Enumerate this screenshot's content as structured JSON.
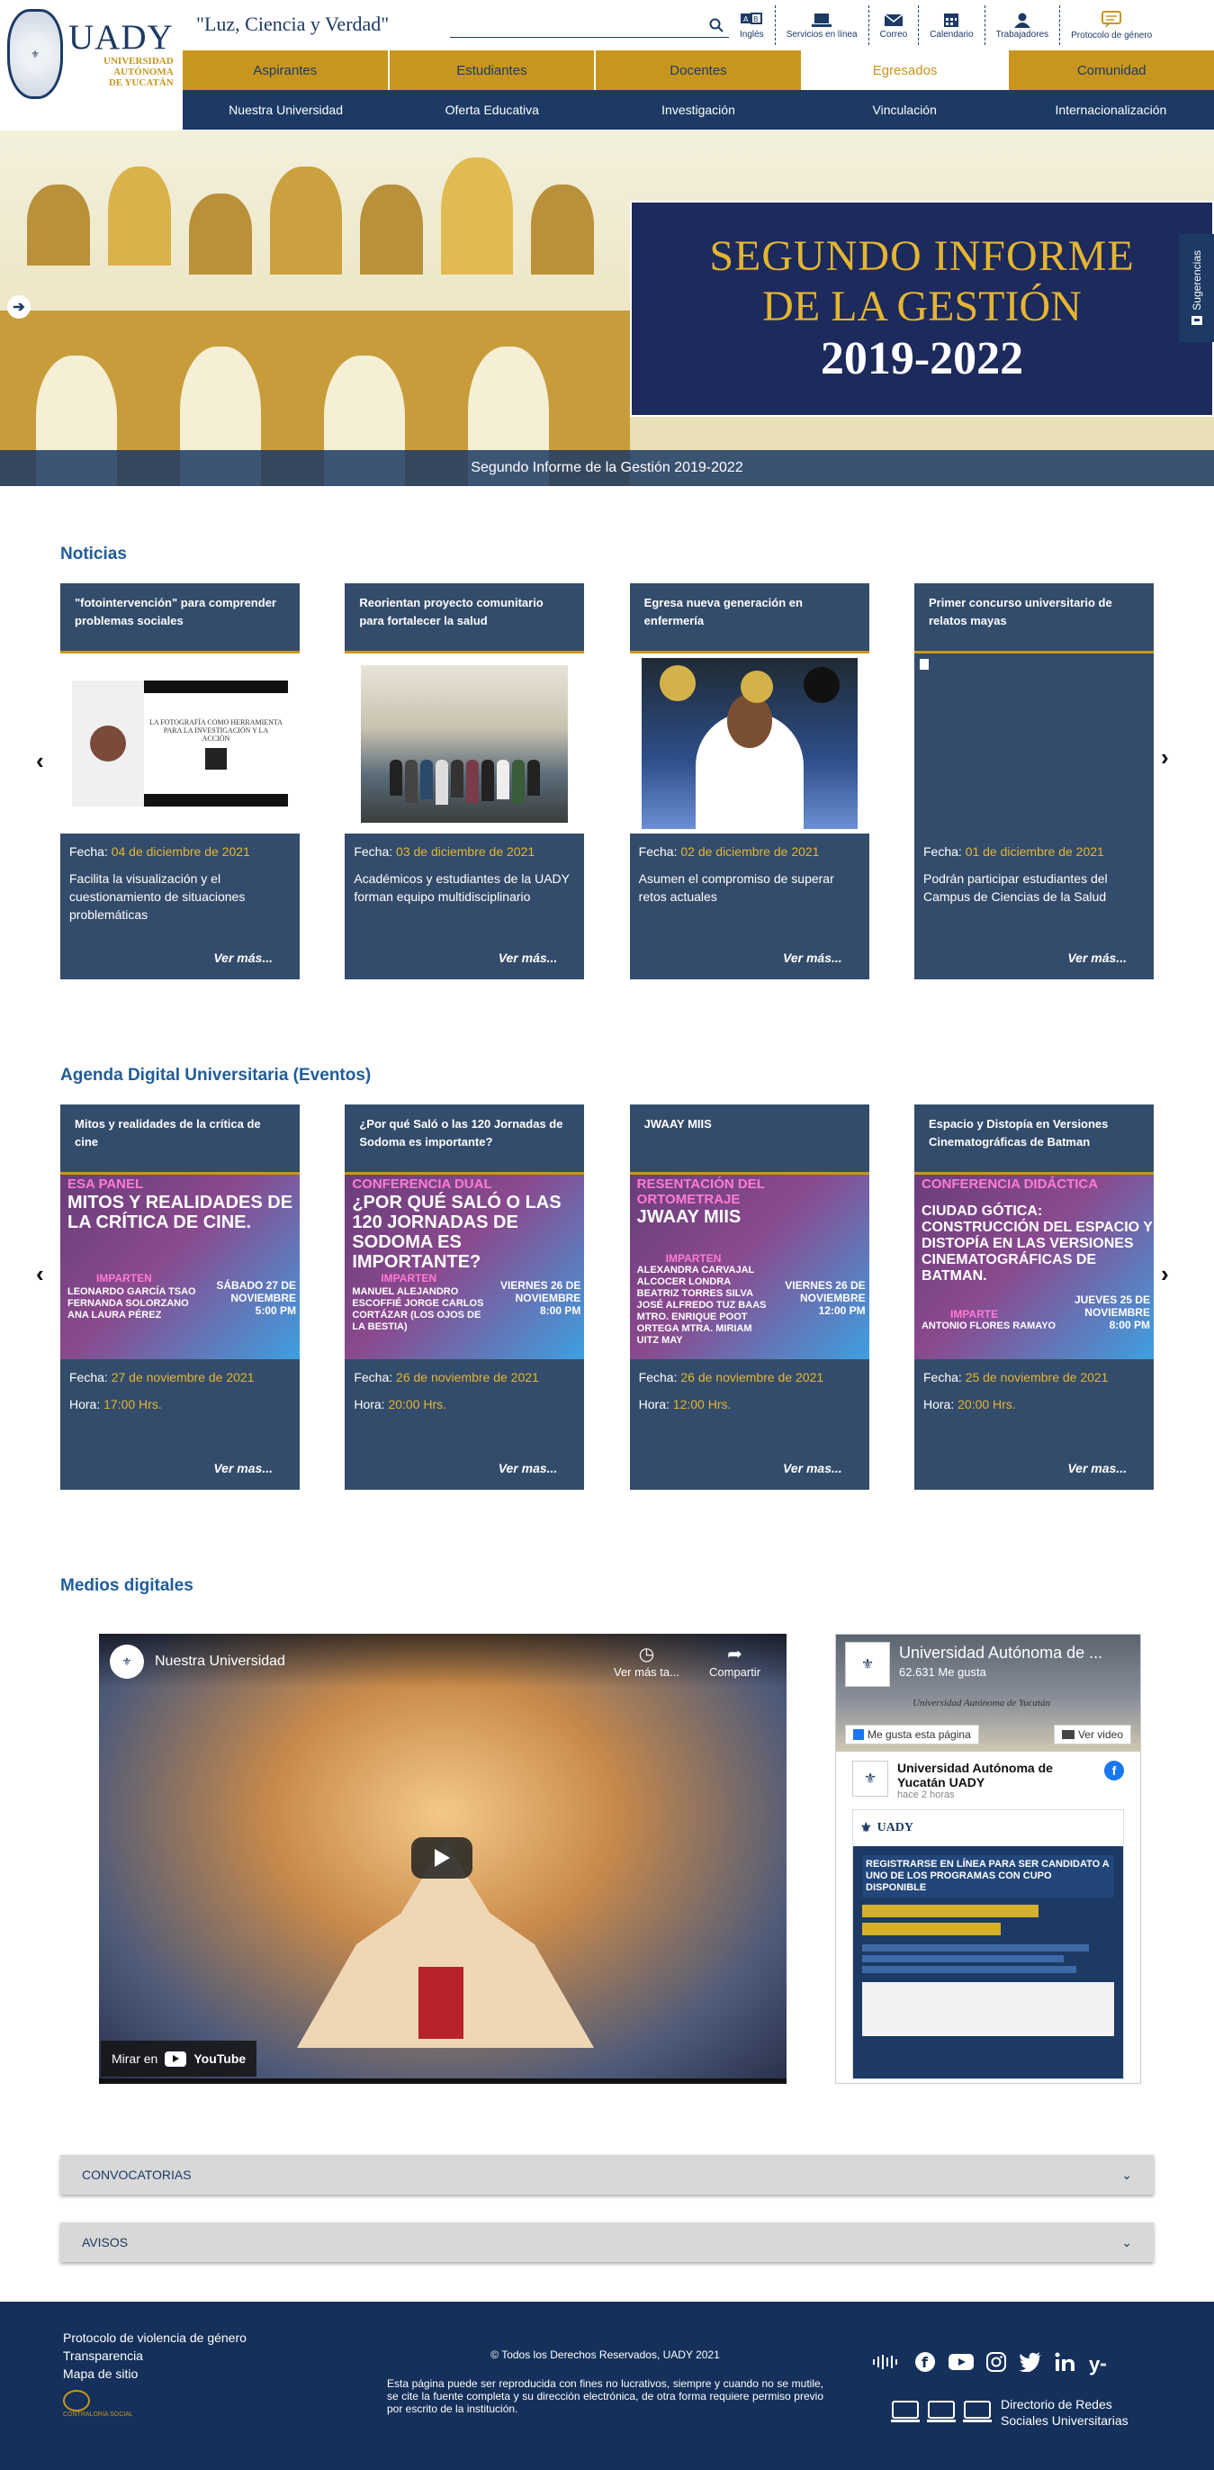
{
  "header": {
    "logo_text": "UADY",
    "logo_sub": [
      "UNIVERSIDAD",
      "AUTÓNOMA",
      "DE YUCATÁN"
    ],
    "motto": "\"Luz, Ciencia y Verdad\"",
    "search_placeholder": ""
  },
  "topnav": [
    {
      "label": "Inglés",
      "icon": "language-icon"
    },
    {
      "label": "Servicios en línea",
      "icon": "laptop-icon"
    },
    {
      "label": "Correo",
      "icon": "mail-icon"
    },
    {
      "label": "Calendario",
      "icon": "calendar-icon"
    },
    {
      "label": "Trabajadores",
      "icon": "user-icon"
    },
    {
      "label": "Protocolo de género",
      "icon": "chat-icon"
    }
  ],
  "nav_primary": [
    "Aspirantes",
    "Estudiantes",
    "Docentes",
    "Egresados",
    "Comunidad"
  ],
  "nav_primary_active": "Egresados",
  "nav_secondary": [
    "Nuestra Universidad",
    "Oferta Educativa",
    "Investigación",
    "Vinculación",
    "Internacionalización"
  ],
  "hero": {
    "line1": "SEGUNDO INFORME",
    "line2": "DE LA GESTIÓN",
    "line3": "2019-2022",
    "caption": "Segundo Informe de la Gestión 2019-2022",
    "side_tab": "Sugerencias"
  },
  "noticias": {
    "title": "Noticias",
    "date_label": "Fecha:",
    "more_label": "Ver más...",
    "items": [
      {
        "title": "\"fotointervención\" para comprender problemas sociales",
        "date": "04 de diciembre de 2021",
        "summary": "Facilita la visualización y el cuestionamiento de situaciones problemáticas",
        "img_text": "LA FOTOGRAFÍA COMO HERRAMIENTA PARA LA INVESTIGACIÓN Y LA ACCIÓN"
      },
      {
        "title": "Reorientan proyecto comunitario para fortalecer la salud",
        "date": "03 de diciembre de 2021",
        "summary": "Académicos y estudiantes de la UADY forman equipo multidisciplinario",
        "img_text": ""
      },
      {
        "title": "Egresa nueva generación en enfermería",
        "date": "02 de diciembre de 2021",
        "summary": "Asumen el compromiso de superar retos actuales",
        "img_text": ""
      },
      {
        "title": "Primer concurso universitario de relatos mayas",
        "date": "01 de diciembre de 2021",
        "summary": "Podrán participar estudiantes del Campus de Ciencias de la Salud",
        "img_text": ""
      }
    ]
  },
  "agenda": {
    "title": "Agenda Digital Universitaria (Eventos)",
    "date_label": "Fecha:",
    "time_label": "Hora:",
    "more_label": "Ver mas...",
    "items": [
      {
        "title": "Mitos y realidades de la crítica de cine",
        "date": "27 de noviembre de 2021",
        "time": "17:00 Hrs.",
        "tag": "ESA PANEL",
        "head": "MITOS Y REALIDADES DE LA CRÍTICA DE CINE.",
        "imparten": "IMPARTEN",
        "names": "LEONARDO GARCÍA TSAO FERNANDA SOLORZANO ANA LAURA PÉREZ",
        "ev_date": "SÁBADO 27 DE NOVIEMBRE 5:00 PM"
      },
      {
        "title": "¿Por qué Saló o las 120 Jornadas de Sodoma es importante?",
        "date": "26 de noviembre de 2021",
        "time": "20:00 Hrs.",
        "tag": "CONFERENCIA DUAL",
        "head": "¿POR QUÉ SALÓ O LAS 120 JORNADAS DE SODOMA ES IMPORTANTE?",
        "imparten": "IMPARTEN",
        "names": "MANUEL ALEJANDRO ESCOFFIÉ JORGE CARLOS CORTÁZAR (LOS OJOS DE LA BESTIA)",
        "ev_date": "VIERNES 26 DE NOVIEMBRE 8:00 PM"
      },
      {
        "title": "JWAAY MIIS",
        "date": "26 de noviembre de 2021",
        "time": "12:00 Hrs.",
        "tag": "RESENTACIÓN DEL ORTOMETRAJE",
        "head": "JWAAY MIIS",
        "imparten": "IMPARTEN",
        "names": "ALEXANDRA CARVAJAL ALCOCER LONDRA BEATRIZ TORRES SILVA JOSÉ ALFREDO TUZ BAAS MTRO. ENRIQUE POOT ORTEGA MTRA. MIRIAM UITZ MAY",
        "ev_date": "VIERNES 26 DE NOVIEMBRE 12:00 PM"
      },
      {
        "title": "Espacio y Distopía en Versiones Cinematográficas de Batman",
        "date": "25 de noviembre de 2021",
        "time": "20:00 Hrs.",
        "tag": "CONFERENCIA DIDÁCTICA",
        "head": "CIUDAD GÓTICA: CONSTRUCCIÓN DEL ESPACIO Y DISTOPÍA EN LAS VERSIONES CINEMATOGRÁFICAS DE BATMAN.",
        "imparten": "IMPARTE",
        "names": "ANTONIO FLORES RAMAYO",
        "ev_date": "JUEVES 25 DE NOVIEMBRE 8:00 PM"
      }
    ]
  },
  "medios": {
    "title": "Medios digitales",
    "video_title": "Nuestra Universidad",
    "watch_later": "Ver más ta...",
    "share": "Compartir",
    "watch_on": "Mirar en",
    "youtube": "YouTube",
    "fb_page": "Universidad Autónoma de ...",
    "fb_likes": "62.631 Me gusta",
    "fb_like_btn": "Me gusta esta página",
    "fb_video_btn": "Ver video",
    "fb_post_author": "Universidad Autónoma de Yucatán UADY",
    "fb_post_time": "hace 2 horas",
    "fb_banner": "Universidad Autónoma de Yucatán",
    "fb_flyer_head": "REGISTRARSE EN LÍNEA PARA SER CANDIDATO A UNO DE LOS PROGRAMAS CON CUPO DISPONIBLE"
  },
  "accordions": [
    "CONVOCATORIAS",
    "AVISOS"
  ],
  "footer": {
    "links": [
      "Protocolo de violencia de género",
      "Transparencia",
      "Mapa de sitio"
    ],
    "contraloria": "CONTRALORÍA SOCIAL",
    "copyright": "© Todos los Derechos Reservados, UADY 2021",
    "note": "Esta página puede ser reproducida con fines no lucrativos, siempre y cuando no se mutile, se cite la fuente completa y su dirección electrónica, de otra forma requiere permiso previo por escrito de la institución.",
    "directory": "Directorio de Redes Sociales Universitarias"
  }
}
